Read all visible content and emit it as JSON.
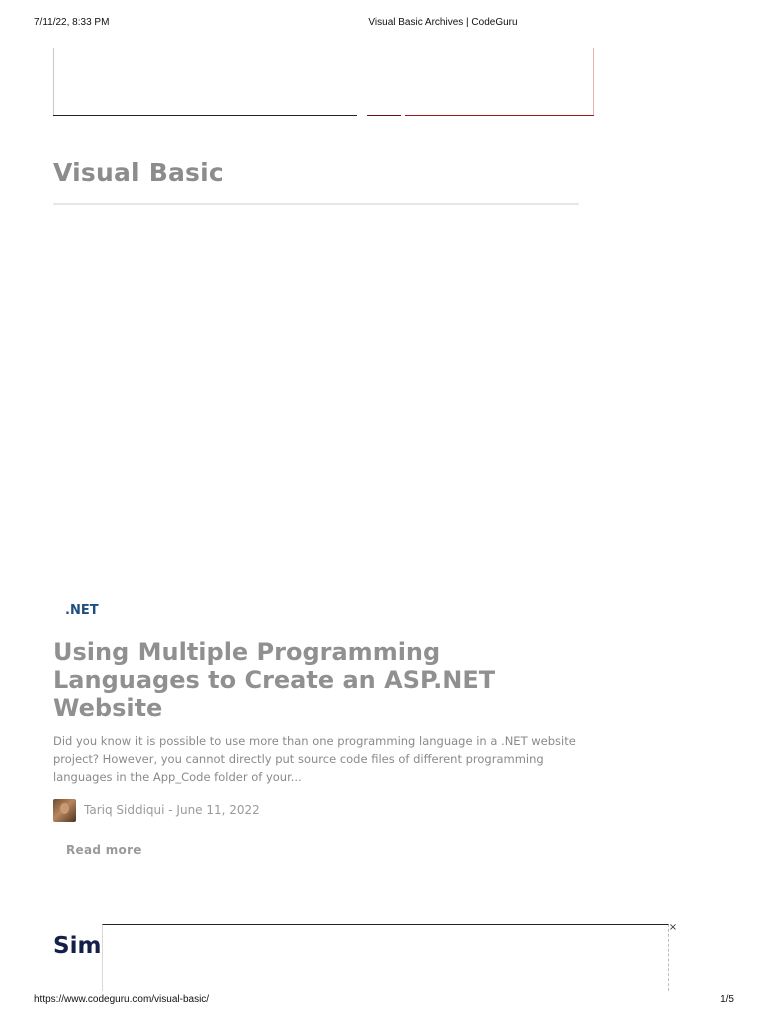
{
  "print_header": {
    "datetime": "7/11/22, 8:33 PM",
    "title": "Visual Basic Archives | CodeGuru"
  },
  "print_footer": {
    "url": "https://www.codeguru.com/visual-basic/",
    "page": "1/5"
  },
  "category": {
    "title": "Visual Basic"
  },
  "article": {
    "tag": ".NET",
    "title": "Using Multiple Programming Languages to Create an ASP.NET Website",
    "excerpt": "Did you know it is possible to use more than one programming language in a .NET website project? However, you cannot directly put source code files of different programming languages in the App_Code folder of your...",
    "byline": "Tariq Siddiqui  -  June 11, 2022",
    "read_more": "Read more"
  },
  "next_section": {
    "heading_partial": "Sim"
  },
  "sticky_ad": {
    "close_symbol": "×"
  },
  "icons": {
    "close": "close-icon",
    "avatar": "author-avatar"
  }
}
